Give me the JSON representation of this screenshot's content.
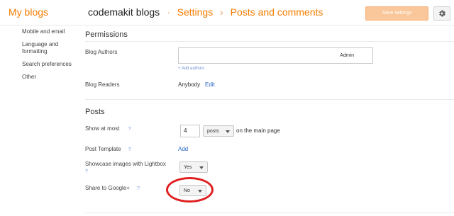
{
  "header": {
    "brand": "My blogs",
    "blog_name": "codemakit blogs",
    "breadcrumb": [
      "Settings",
      "Posts and comments"
    ],
    "save_label": "Save settings"
  },
  "sidebar": {
    "items": [
      "Mobile and email",
      "Language and formatting",
      "Search preferences",
      "Other"
    ]
  },
  "permissions": {
    "title": "Permissions",
    "blog_authors_label": "Blog Authors",
    "author_role": "Admin",
    "add_authors": "+ Add authors",
    "blog_readers_label": "Blog Readers",
    "blog_readers_value": "Anybody",
    "edit_label": "Edit"
  },
  "posts": {
    "title": "Posts",
    "show_at_most_label": "Show at most",
    "show_at_most_value": "4",
    "unit_selected": "posts",
    "on_main_page": "on the main page",
    "post_template_label": "Post Template",
    "post_template_action": "Add",
    "lightbox_label": "Showcase images with Lightbox",
    "lightbox_value": "Yes",
    "google_label": "Share to Google+",
    "google_value": "No"
  },
  "help_glyph": "?",
  "colors": {
    "accent": "#f57d00",
    "link": "#2a67c8",
    "annotation": "#e02020"
  }
}
